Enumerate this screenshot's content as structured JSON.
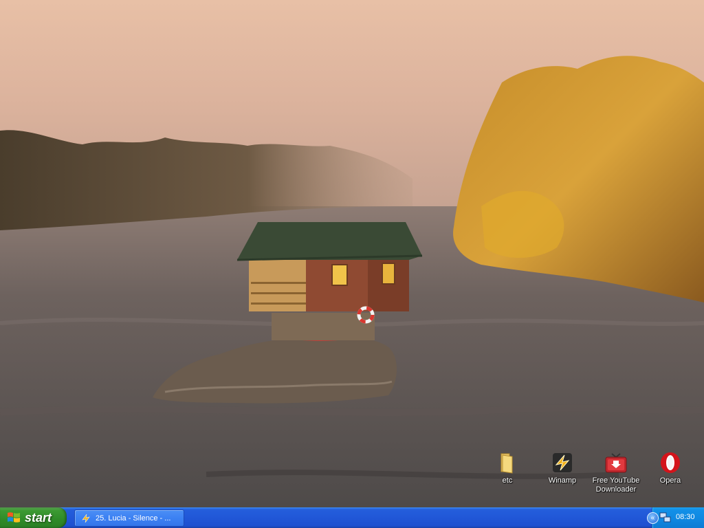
{
  "desktop": {
    "icons": [
      {
        "label": "etc",
        "icon": "folder-icon"
      },
      {
        "label": "Winamp",
        "icon": "winamp-icon"
      },
      {
        "label": "Free YouTube Downloader",
        "icon": "youtube-downloader-icon"
      },
      {
        "label": "Opera",
        "icon": "opera-icon"
      }
    ]
  },
  "taskbar": {
    "start_label": "start",
    "task_button_label": "25. Lucia - Silence - ...",
    "tray": {
      "time": "08:30",
      "chevron": "«"
    }
  },
  "colors": {
    "taskbar_blue": "#245edc",
    "start_green": "#3c9a33",
    "tray_blue": "#0f87e0"
  }
}
